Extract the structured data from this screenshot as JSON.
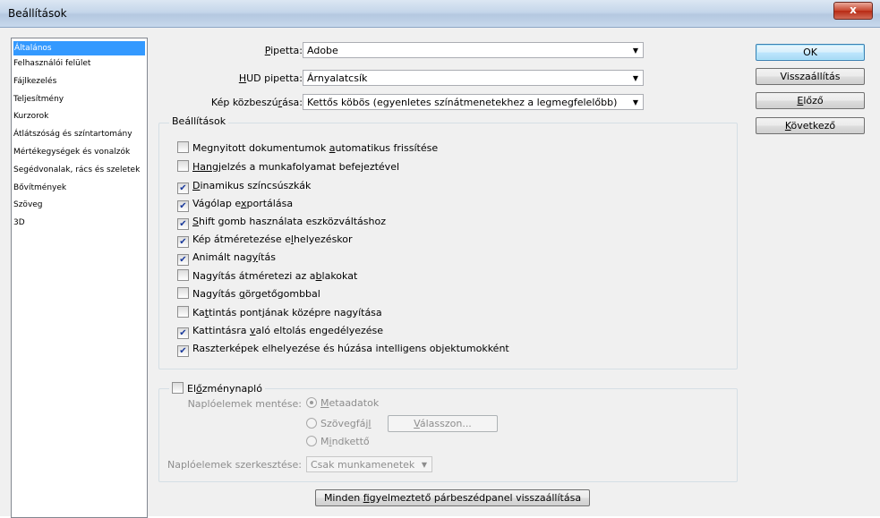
{
  "window": {
    "title": "Beállítások",
    "close_glyph": "x"
  },
  "sidebar": {
    "items": [
      {
        "label": "Általános",
        "selected": true
      },
      {
        "label": "Felhasználói felület"
      },
      {
        "label": "Fájlkezelés"
      },
      {
        "label": "Teljesítmény"
      },
      {
        "label": "Kurzorok"
      },
      {
        "label": "Átlátszóság és színtartomány"
      },
      {
        "label": "Mértékegységek és vonalzók"
      },
      {
        "label": "Segédvonalak, rács és szeletek"
      },
      {
        "label": "Bővítmények"
      },
      {
        "label": "Szöveg"
      },
      {
        "label": "3D"
      }
    ]
  },
  "general": {
    "pipetta_label_pre": "",
    "pipetta_label_u": "P",
    "pipetta_label_post": "ipetta:",
    "pipetta_value": "Adobe",
    "hud_label_u": "H",
    "hud_label_post": "UD pipetta:",
    "hud_value": "Árnyalatcsík",
    "interp_label_pre": "Kép közbeszú",
    "interp_label_u": "r",
    "interp_label_post": "ása:",
    "interp_value": "Kettős köbös (egyenletes színátmenetekhez a legmegfelelőbb)"
  },
  "options_group": {
    "legend": "Beállítások",
    "items": [
      {
        "pre": "Megnyitott dokumentumok ",
        "u": "a",
        "post": "utomatikus frissítése",
        "checked": false
      },
      {
        "pre": "",
        "u": "Hangj",
        "post": "elzés a munkafolyamat befejeztével",
        "checked": false
      },
      {
        "pre": "",
        "u": "D",
        "post": "inamikus színcsúszkák",
        "checked": true
      },
      {
        "pre": "Vágólap e",
        "u": "x",
        "post": "portálása",
        "checked": true
      },
      {
        "pre": "",
        "u": "S",
        "post": "hift gomb használata eszközváltáshoz",
        "checked": true
      },
      {
        "pre": "Kép átméretezése e",
        "u": "l",
        "post": "helyezéskor",
        "checked": true
      },
      {
        "pre": "Animált nag",
        "u": "y",
        "post": "ítás",
        "checked": true
      },
      {
        "pre": "Nagyítás átméretezi az a",
        "u": "b",
        "post": "lakokat",
        "checked": false
      },
      {
        "pre": "Nagyítás ",
        "u": "g",
        "post": "örgetőgombbal",
        "checked": false
      },
      {
        "pre": "Ka",
        "u": "t",
        "post": "tintás pontjának középre nagyítása",
        "checked": false
      },
      {
        "pre": "Kattintásra ",
        "u": "v",
        "post": "aló eltolás engedélyezése",
        "checked": true
      },
      {
        "pre": "Raszterképek elhelyezése és húzása intelligens objektumokként",
        "u": "",
        "post": "",
        "checked": true
      }
    ]
  },
  "history_group": {
    "legend_pre": "El",
    "legend_u": "ő",
    "legend_post": "zménynapló",
    "save_label": "Naplóelemek mentése:",
    "radio1_u": "M",
    "radio1_post": "etaadatok",
    "radio2_pre": "Szövegfáj",
    "radio2_u": "l",
    "radio2_post": "",
    "radio3_pre": "M",
    "radio3_u": "i",
    "radio3_post": "ndkettő",
    "choose_btn_u": "V",
    "choose_btn_post": "álasszon...",
    "edit_label": "Naplóelemek szerkesztése:",
    "edit_value": "Csak munkamenetek"
  },
  "reset_warnings": {
    "pre": "Minden ",
    "u": "f",
    "post": "igyelmeztető párbeszédpanel visszaállítása"
  },
  "buttons": {
    "ok": "OK",
    "reset": "Visszaállítás",
    "prev_u": "E",
    "prev_post": "lőző",
    "next_u": "K",
    "next_post": "övetkező"
  },
  "icons": {
    "checkmark": "✔",
    "dropdown": "▼"
  }
}
